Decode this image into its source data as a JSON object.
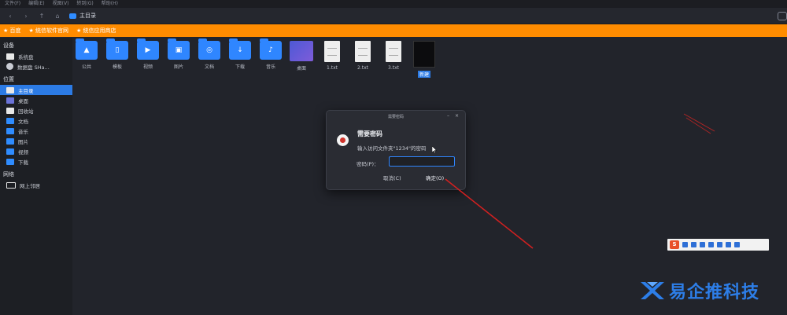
{
  "menubar": {
    "items": [
      "文件(F)",
      "编辑(E)",
      "视图(V)",
      "转到(G)",
      "帮助(H)"
    ]
  },
  "toolbar": {
    "back": "‹",
    "forward": "›",
    "up": "↑",
    "home": "⌂",
    "path": "主目录"
  },
  "bookmarks": [
    "★ 百度",
    "★ 统信软件官网",
    "★ 统信应用商店"
  ],
  "sidebar": {
    "device_header": "设备",
    "devices": [
      {
        "label": "系统盘"
      },
      {
        "label": "数据盘 SHa..."
      }
    ],
    "places_header": "位置",
    "places": [
      {
        "label": "主目录",
        "active": true
      },
      {
        "label": "桌面"
      },
      {
        "label": "回收站"
      },
      {
        "label": "文档"
      },
      {
        "label": "音乐"
      },
      {
        "label": "图片"
      },
      {
        "label": "视频"
      },
      {
        "label": "下载"
      }
    ],
    "network_header": "网络",
    "network": [
      {
        "label": "网上邻居"
      }
    ]
  },
  "files": [
    {
      "name": "公共",
      "kind": "folder",
      "glyph": "▲"
    },
    {
      "name": "模板",
      "kind": "folder",
      "glyph": "▯"
    },
    {
      "name": "视频",
      "kind": "folder",
      "glyph": "▶"
    },
    {
      "name": "图片",
      "kind": "folder",
      "glyph": "▣"
    },
    {
      "name": "文档",
      "kind": "folder",
      "glyph": "◎"
    },
    {
      "name": "下载",
      "kind": "folder",
      "glyph": "↓"
    },
    {
      "name": "音乐",
      "kind": "folder",
      "glyph": "♪"
    },
    {
      "name": "桌面",
      "kind": "image"
    },
    {
      "name": "1.txt",
      "kind": "doc"
    },
    {
      "name": "2.txt",
      "kind": "doc"
    },
    {
      "name": "3.txt",
      "kind": "doc"
    },
    {
      "name": "新建",
      "kind": "black",
      "selected": true
    }
  ],
  "dialog": {
    "title": "需要密码",
    "min": "–",
    "close": "×",
    "heading": "需要密码",
    "message": "输入访问文件夹\"1234\"的密码",
    "password_label": "密码(P)：",
    "password_value": "",
    "cancel_label": "取消(C)",
    "ok_label": "确定(O)"
  },
  "ime": {
    "logo": "S"
  },
  "watermark": {
    "text": "易企推科技"
  },
  "colors": {
    "accent": "#2f86ff",
    "bookmark_bar": "#ff8c00",
    "arrow": "#d42020"
  }
}
